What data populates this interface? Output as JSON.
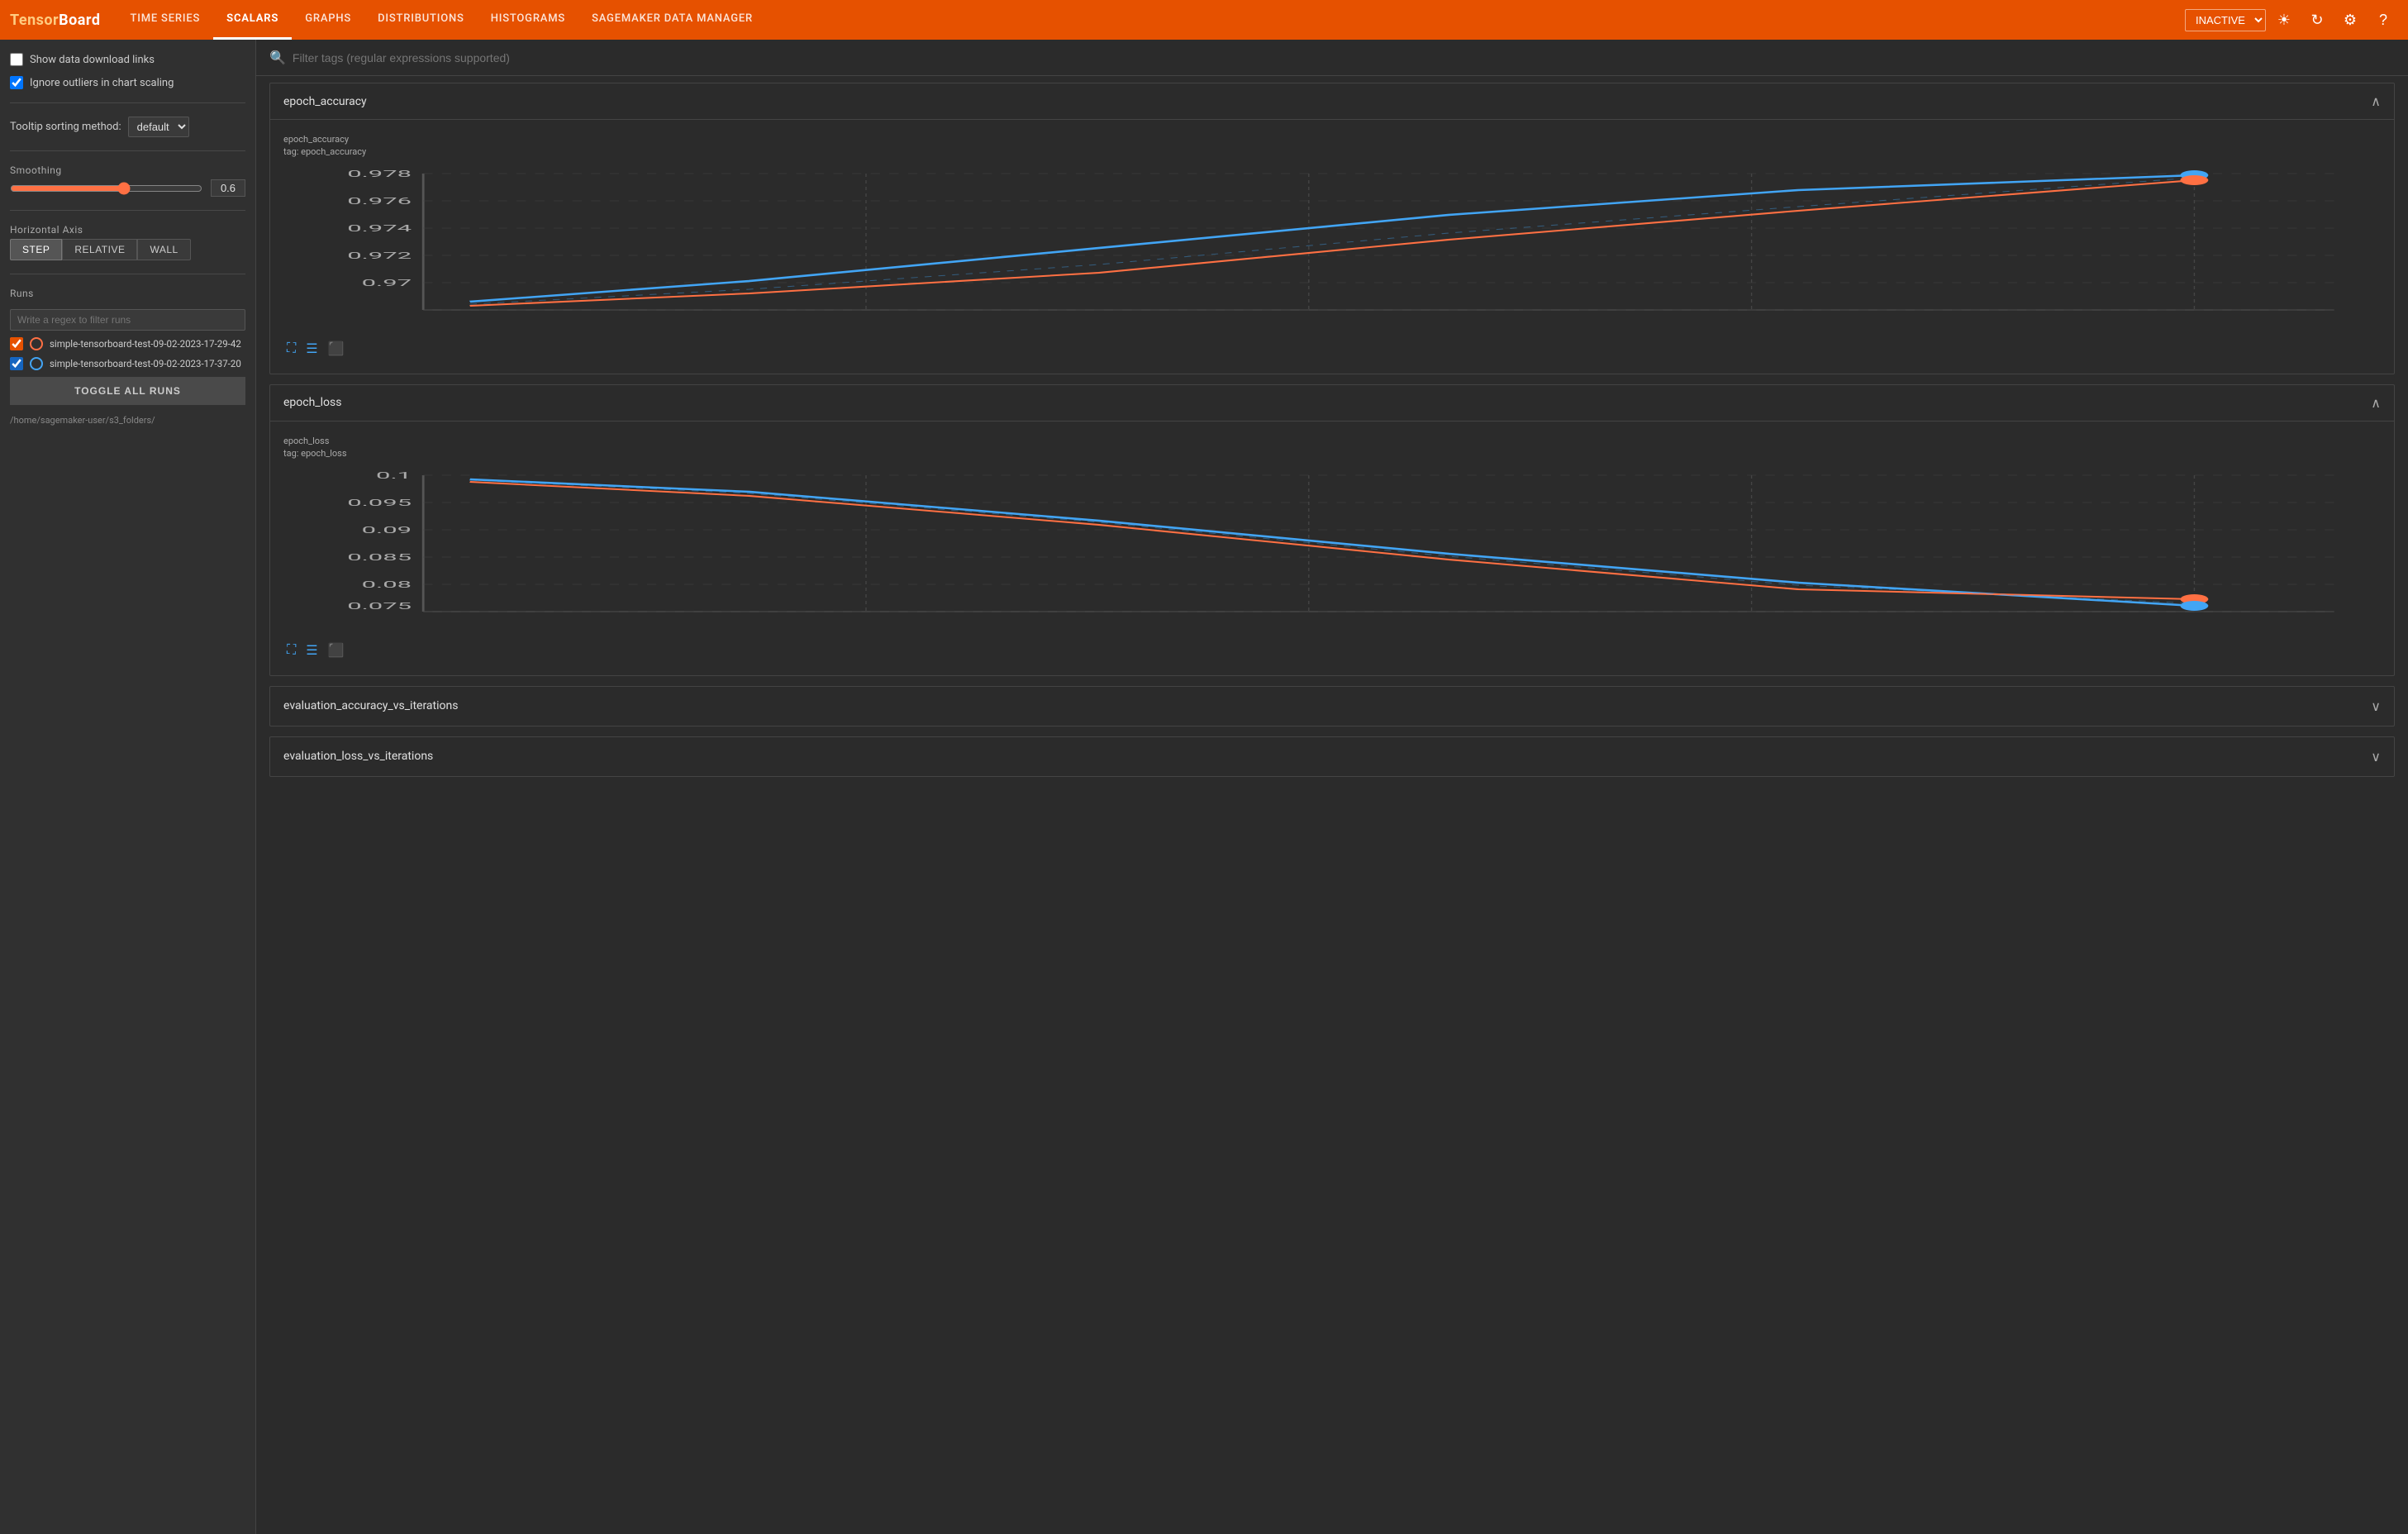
{
  "app": {
    "logo_tensor": "Tensor",
    "logo_board": "Board"
  },
  "nav": {
    "links": [
      {
        "id": "time-series",
        "label": "TIME SERIES",
        "active": false
      },
      {
        "id": "scalars",
        "label": "SCALARS",
        "active": true
      },
      {
        "id": "graphs",
        "label": "GRAPHS",
        "active": false
      },
      {
        "id": "distributions",
        "label": "DISTRIBUTIONS",
        "active": false
      },
      {
        "id": "histograms",
        "label": "HISTOGRAMS",
        "active": false
      },
      {
        "id": "sagemaker",
        "label": "SAGEMAKER DATA MANAGER",
        "active": false
      }
    ],
    "status": "INACTIVE"
  },
  "sidebar": {
    "show_download": "Show data download links",
    "ignore_outliers": "Ignore outliers in chart scaling",
    "tooltip_label": "Tooltip sorting method:",
    "tooltip_value": "default",
    "smoothing_label": "Smoothing",
    "smoothing_value": "0.6",
    "axis_label": "Horizontal Axis",
    "axis_options": [
      "STEP",
      "RELATIVE",
      "WALL"
    ],
    "axis_active": "STEP",
    "runs_label": "Runs",
    "runs_filter_placeholder": "Write a regex to filter runs",
    "runs": [
      {
        "id": "run1",
        "label": "simple-tensorboard-test-09-02-2023-17-29-42",
        "checked": true,
        "color": "orange"
      },
      {
        "id": "run2",
        "label": "simple-tensorboard-test-09-02-2023-17-37-20",
        "checked": true,
        "color": "blue"
      }
    ],
    "toggle_all": "TOGGLE ALL RUNS",
    "path": "/home/sagemaker-user/s3_folders/"
  },
  "filter": {
    "placeholder": "Filter tags (regular expressions supported)"
  },
  "charts": [
    {
      "id": "epoch_accuracy",
      "title": "epoch_accuracy",
      "collapsed": false,
      "meta_line1": "epoch_accuracy",
      "meta_line2": "tag: epoch_accuracy",
      "y_values": [
        "0.978",
        "0.976",
        "0.974",
        "0.972",
        "0.97"
      ],
      "type": "accuracy"
    },
    {
      "id": "epoch_loss",
      "title": "epoch_loss",
      "collapsed": false,
      "meta_line1": "epoch_loss",
      "meta_line2": "tag: epoch_loss",
      "y_values": [
        "0.1",
        "0.095",
        "0.09",
        "0.085",
        "0.08",
        "0.075"
      ],
      "type": "loss"
    },
    {
      "id": "eval_accuracy",
      "title": "evaluation_accuracy_vs_iterations",
      "collapsed": true
    },
    {
      "id": "eval_loss",
      "title": "evaluation_loss_vs_iterations",
      "collapsed": true
    }
  ]
}
